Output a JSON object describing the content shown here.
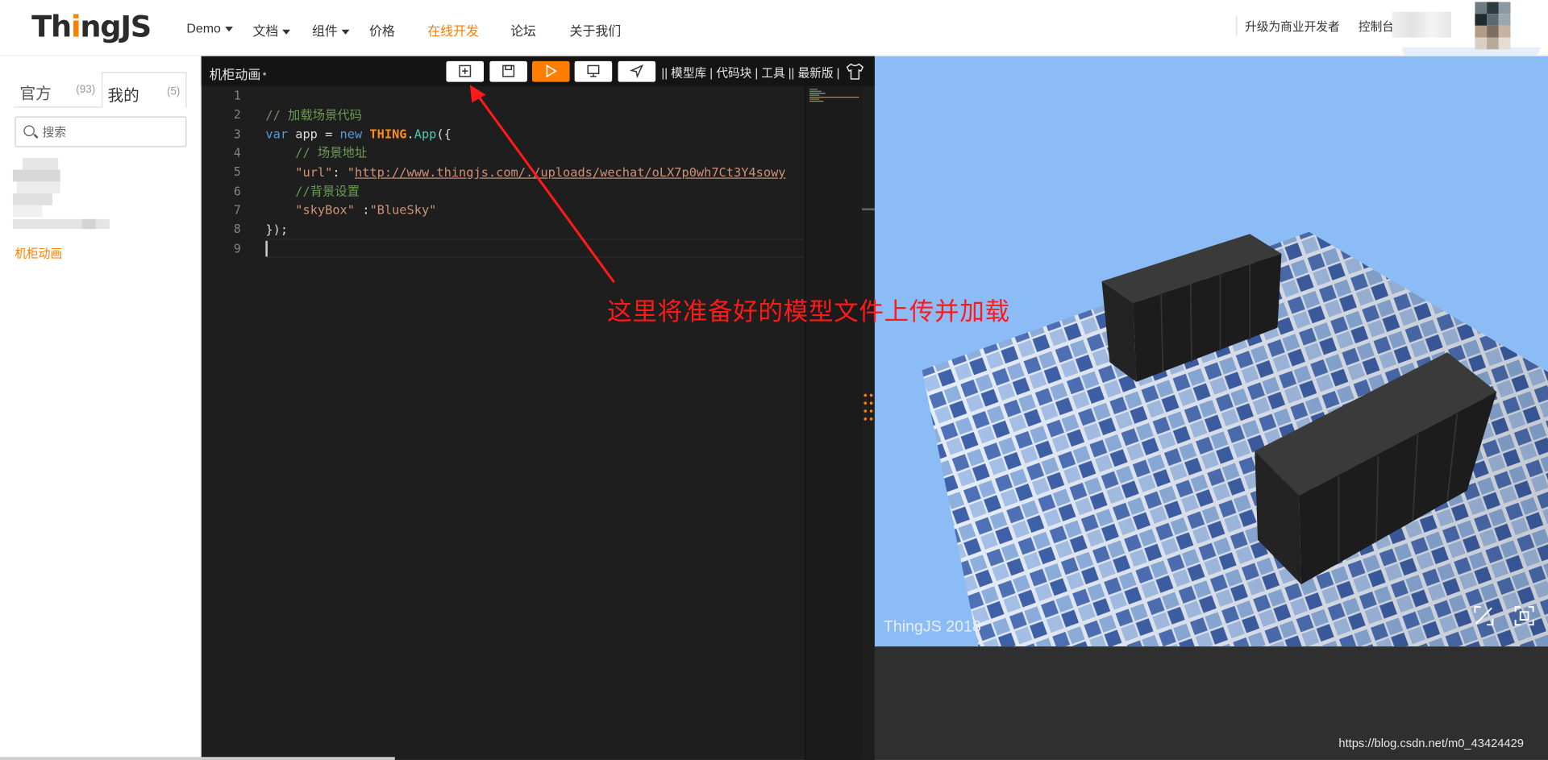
{
  "nav": {
    "logo_prefix": "Th",
    "logo_i": "i",
    "logo_suffix": "ngJS",
    "items": [
      {
        "label": "Demo"
      },
      {
        "label": "文档"
      },
      {
        "label": "组件"
      },
      {
        "label": "价格"
      },
      {
        "label": "在线开发"
      },
      {
        "label": "论坛"
      },
      {
        "label": "关于我们"
      }
    ],
    "upgrade": "升级为商业开发者",
    "console": "控制台"
  },
  "sidebar": {
    "tab_official": "官方",
    "tab_official_count": "(93)",
    "tab_mine": "我的",
    "tab_mine_count": "(5)",
    "search_placeholder": "搜索",
    "item_label": "机柜动画"
  },
  "editor": {
    "title": "机柜动画",
    "modified_marker": "*",
    "links": "|| 模型库 | 代码块 | 工具 || 最新版 |",
    "line_numbers": [
      "1",
      "2",
      "3",
      "4",
      "5",
      "6",
      "7",
      "8",
      "9"
    ],
    "code": {
      "l2": "// 加载场景代码",
      "l3_kw1": "var",
      "l3_app": " app = ",
      "l3_kw2": "new",
      "l3_thing": "THING",
      "l3_dot": ".",
      "l3_cls": "App",
      "l3_end": "({",
      "l4": "// 场景地址",
      "l5_key": "\"url\"",
      "l5_colon": ": ",
      "l5_quote": "\"",
      "l5_url": "http://www.thingjs.com/./uploads/wechat/oLX7p0wh7Ct3Y4sowy",
      "l6": "//背景设置",
      "l7_key": "\"skyBox\"",
      "l7_colon": " :",
      "l7_val": "\"BlueSky\"",
      "l8": "});"
    }
  },
  "viewport": {
    "brand": "ThingJS 2018"
  },
  "annotation": {
    "text": "这里将准备好的模型文件上传并加载"
  },
  "watermark": "https://blog.csdn.net/m0_43424429",
  "colors": {
    "accent": "#ff7e00",
    "annotation": "#ff1a1a",
    "editor_bg": "#1e1e1e",
    "viewport_sky": "#8cbcf5"
  }
}
